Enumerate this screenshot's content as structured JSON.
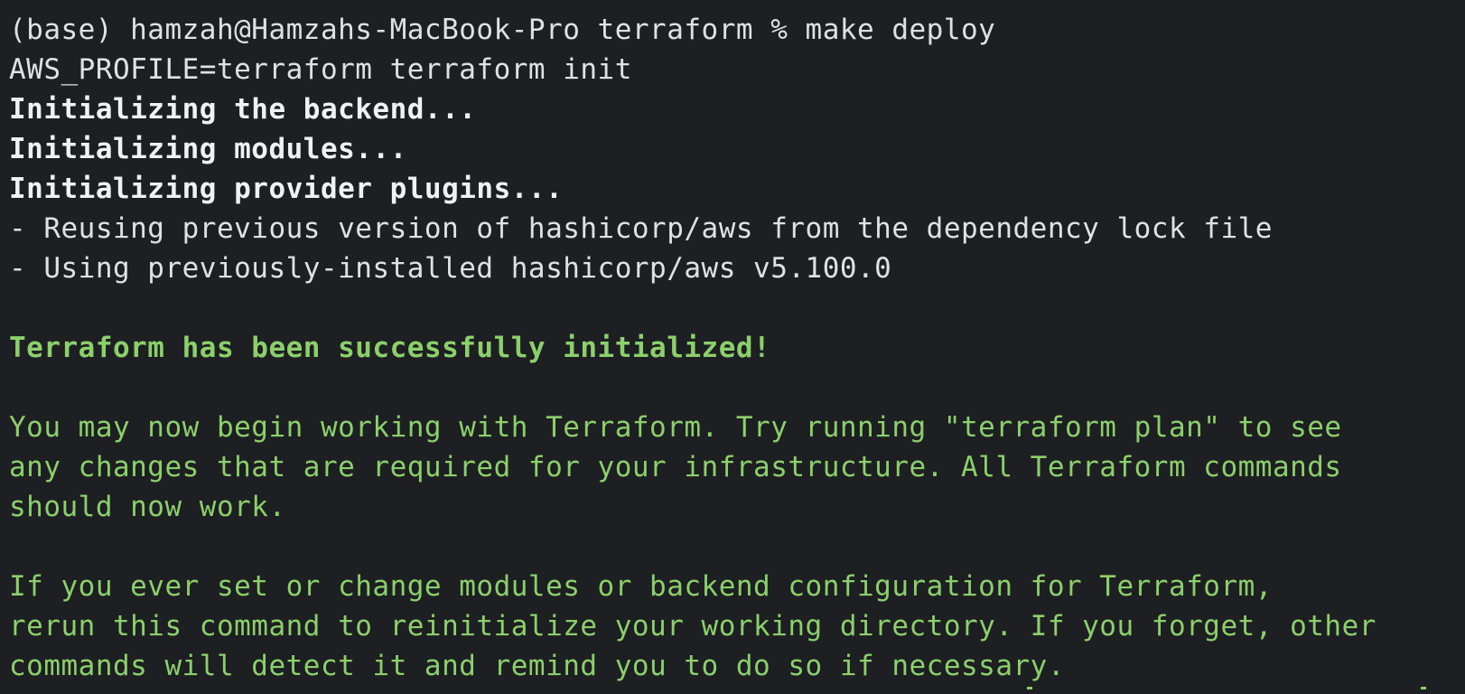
{
  "terminal": {
    "lines": [
      {
        "text": "(base) hamzah@Hamzahs-MacBook-Pro terraform % make deploy",
        "style": "normal"
      },
      {
        "text": "AWS_PROFILE=terraform terraform init",
        "style": "normal"
      },
      {
        "text": "Initializing the backend...",
        "style": "bold"
      },
      {
        "text": "Initializing modules...",
        "style": "bold"
      },
      {
        "text": "Initializing provider plugins...",
        "style": "bold"
      },
      {
        "text": "- Reusing previous version of hashicorp/aws from the dependency lock file",
        "style": "normal"
      },
      {
        "text": "- Using previously-installed hashicorp/aws v5.100.0",
        "style": "normal"
      },
      {
        "text": "",
        "style": "blank"
      },
      {
        "text": "Terraform has been successfully initialized!",
        "style": "bold-green"
      },
      {
        "text": "",
        "style": "blank"
      },
      {
        "text": "You may now begin working with Terraform. Try running \"terraform plan\" to see",
        "style": "green"
      },
      {
        "text": "any changes that are required for your infrastructure. All Terraform commands",
        "style": "green"
      },
      {
        "text": "should now work.",
        "style": "green"
      },
      {
        "text": "",
        "style": "blank"
      },
      {
        "text": "If you ever set or change modules or backend configuration for Terraform,",
        "style": "green"
      },
      {
        "text": "rerun this command to reinitialize your working directory. If you forget, other",
        "style": "green"
      },
      {
        "text": "commands will detect it and remind you to do so if necessary.",
        "style": "green"
      }
    ],
    "colors": {
      "background": "#1e1f22",
      "text": "#dfe1e5",
      "bold_text": "#f0f1f4",
      "success": "#8bd06b"
    }
  }
}
